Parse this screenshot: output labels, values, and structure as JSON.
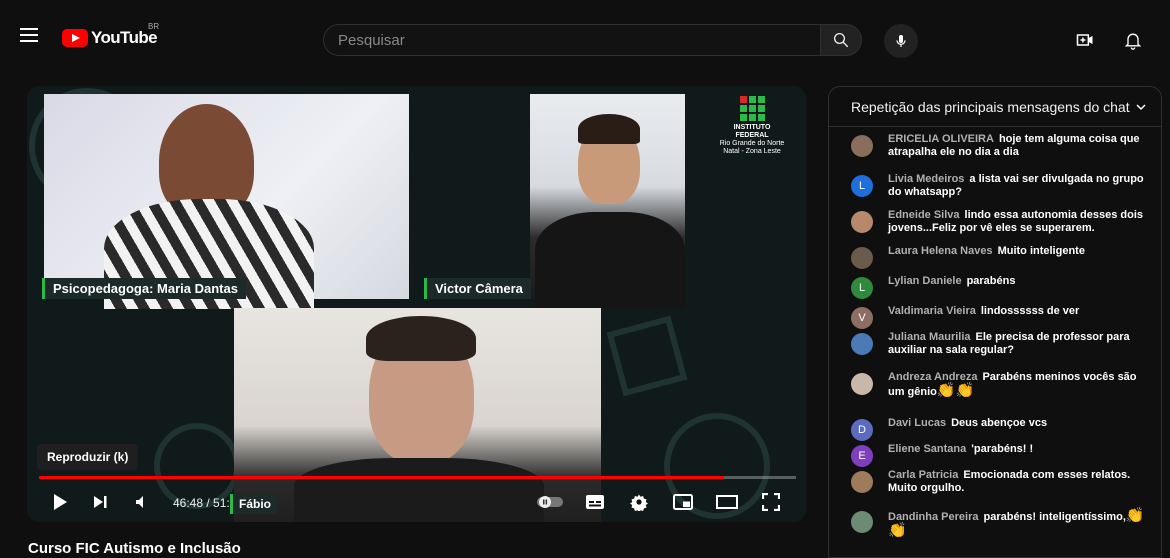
{
  "header": {
    "logo_text": "YouTube",
    "country_code": "BR",
    "search_placeholder": "Pesquisar"
  },
  "player": {
    "speakers": {
      "top_left": "Psicopedagoga: Maria Dantas",
      "top_right": "Victor Câmera",
      "bottom": "Fábio"
    },
    "institute_logo": [
      "INSTITUTO",
      "FEDERAL",
      "Rio Grande do Norte",
      "Natal - Zona Leste"
    ],
    "tooltip": "Reproduzir (k)",
    "time": "46:48 / 51:44",
    "progress_fraction": 0.905
  },
  "video_title": "Curso FIC Autismo e Inclusão",
  "chat": {
    "header": "Repetição das principais mensagens do chat",
    "messages": [
      {
        "author": "ERICELIA OLIVEIRA",
        "text": "hoje tem alguma coisa que atrapalha ele no dia a dia",
        "avatar": "",
        "avatar_color": "#8a6d5a"
      },
      {
        "author": "Livia Medeiros",
        "text": "a lista vai ser divulgada no grupo do whatsapp?",
        "avatar": "L",
        "avatar_color": "#1e6fd9"
      },
      {
        "author": "Edneide Silva",
        "text": "lindo essa autonomia desses dois jovens...Feliz por vê eles se superarem.",
        "avatar": "",
        "avatar_color": "#b58a6b"
      },
      {
        "author": "Laura Helena Naves",
        "text": "Muito inteligente",
        "avatar": "",
        "avatar_color": "#6b5b4a"
      },
      {
        "author": "Lylian Daniele",
        "text": "parabéns",
        "avatar": "L",
        "avatar_color": "#2e8b3e"
      },
      {
        "author": "Valdimaria Vieira",
        "text": "lindossssss de ver",
        "avatar": "V",
        "avatar_color": "#8d6e63"
      },
      {
        "author": "Juliana Maurilia",
        "text": "Ele precisa de professor para auxiliar na sala regular?",
        "avatar": "",
        "avatar_color": "#4a7bb7"
      },
      {
        "author": "Andreza Andreza",
        "text": "Parabéns meninos vocês são um gênio",
        "avatar": "",
        "avatar_color": "#c9b8a8"
      },
      {
        "author": "Davi Lucas",
        "text": "Deus abençoe vcs",
        "avatar": "D",
        "avatar_color": "#5c6bc0"
      },
      {
        "author": "Eliene Santana",
        "text": "'parabéns! !",
        "avatar": "E",
        "avatar_color": "#7e3fbf"
      },
      {
        "author": "Carla Patricia",
        "text": "Emocionada com esses relatos. Muito orgulho.",
        "avatar": "",
        "avatar_color": "#9e7b5c"
      },
      {
        "author": "Dandinha Pereira",
        "text": "parabéns! inteligentíssimo,",
        "avatar": "",
        "avatar_color": "#6d8b74"
      }
    ]
  }
}
